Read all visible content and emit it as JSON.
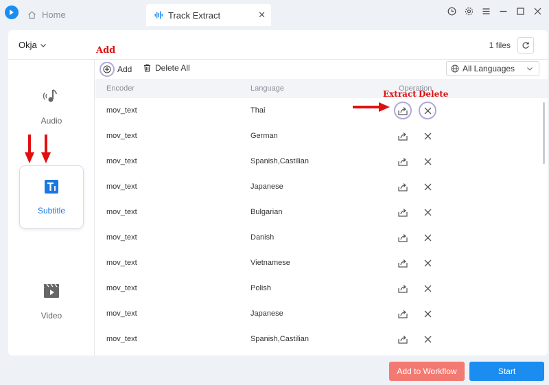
{
  "tabs": {
    "home_label": "Home",
    "active_label": "Track Extract"
  },
  "header": {
    "file_name": "Okja",
    "files_count": "1 files"
  },
  "sidebar": {
    "items": [
      {
        "label": "Audio"
      },
      {
        "label": "Subtitle"
      },
      {
        "label": "Video"
      }
    ]
  },
  "toolbar": {
    "add_label": "Add",
    "delete_all_label": "Delete All",
    "language_filter": "All Languages"
  },
  "table": {
    "headers": [
      "Encoder",
      "Language",
      "Operation"
    ],
    "rows": [
      {
        "encoder": "mov_text",
        "language": "Thai"
      },
      {
        "encoder": "mov_text",
        "language": "German"
      },
      {
        "encoder": "mov_text",
        "language": "Spanish,Castilian"
      },
      {
        "encoder": "mov_text",
        "language": "Japanese"
      },
      {
        "encoder": "mov_text",
        "language": "Bulgarian"
      },
      {
        "encoder": "mov_text",
        "language": "Danish"
      },
      {
        "encoder": "mov_text",
        "language": "Vietnamese"
      },
      {
        "encoder": "mov_text",
        "language": "Polish"
      },
      {
        "encoder": "mov_text",
        "language": "Japanese"
      },
      {
        "encoder": "mov_text",
        "language": "Spanish,Castilian"
      }
    ]
  },
  "footer": {
    "workflow_label": "Add to Workflow",
    "start_label": "Start"
  },
  "annotations": {
    "add": "Add",
    "extract": "Extract",
    "delete": "Delete"
  },
  "colors": {
    "accent": "#1b8cf0",
    "workflow": "#f37a72",
    "annotation": "#e01010"
  }
}
